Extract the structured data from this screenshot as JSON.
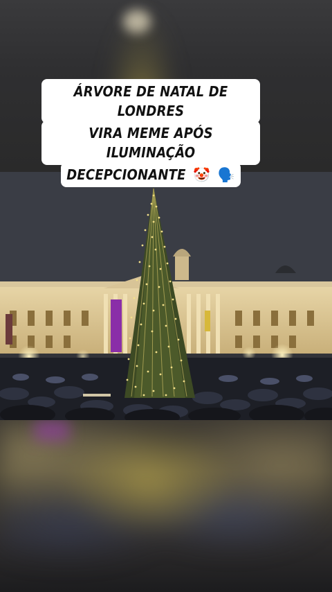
{
  "caption": {
    "line1": "ÁRVORE DE NATAL DE LONDRES",
    "line2": "VIRA MEME APÓS ILUMINAÇÃO",
    "line3": "DECEPCIONANTE",
    "emoji_clown": "🤡",
    "emoji_speaking": "🗣️"
  },
  "icons": {
    "clown": "clown-face-icon",
    "speaking": "speaking-head-icon"
  },
  "colors": {
    "caption_bg": "#ffffff",
    "caption_text": "#111111",
    "tree_lights": "#e8d67a",
    "sky": "#3b3e46"
  }
}
